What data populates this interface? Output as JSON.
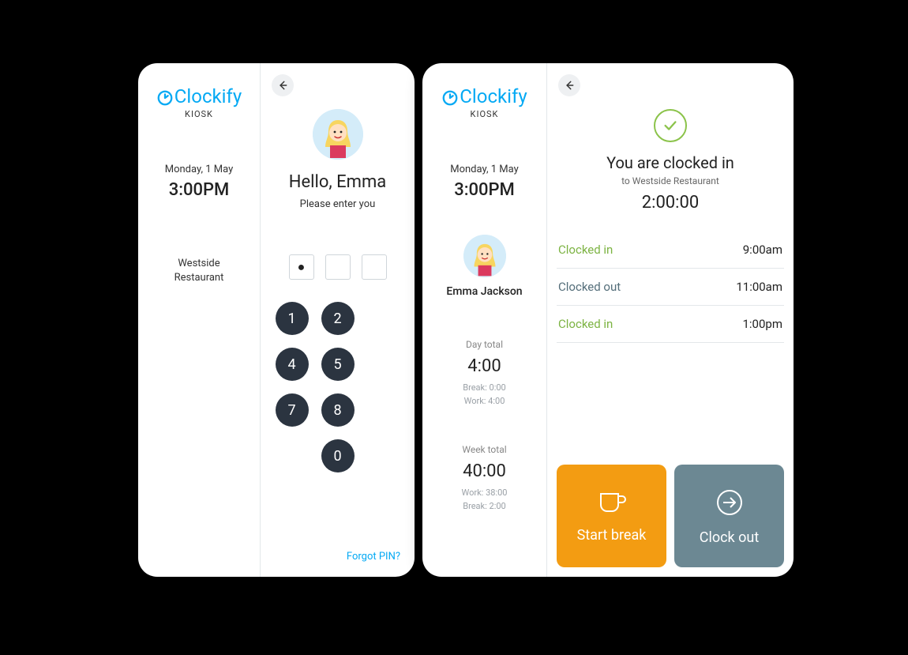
{
  "brand": {
    "name": "Clockify",
    "kiosk_label": "KIOSK"
  },
  "left": {
    "date": "Monday, 1 May",
    "time": "3:00PM",
    "location": "Westside Restaurant",
    "hello": "Hello, Emma",
    "instruction": "Please enter you",
    "pin_boxes": [
      "●",
      "",
      ""
    ],
    "keys": [
      "1",
      "2",
      "4",
      "5",
      "7",
      "8",
      "0"
    ],
    "forgot": "Forgot PIN?"
  },
  "right": {
    "date": "Monday, 1 May",
    "time": "3:00PM",
    "person": "Emma Jackson",
    "day_label": "Day total",
    "day_total": "4:00",
    "day_break": "Break: 0:00",
    "day_work": "Work: 4:00",
    "week_label": "Week total",
    "week_total": "40:00",
    "week_work": "Work: 38:00",
    "week_break": "Break: 2:00",
    "status_title": "You are clocked in",
    "status_sub": "to Westside Restaurant",
    "elapsed": "2:00:00",
    "log": [
      {
        "label": "Clocked in",
        "time": "9:00am",
        "kind": "in"
      },
      {
        "label": "Clocked out",
        "time": "11:00am",
        "kind": "out"
      },
      {
        "label": "Clocked in",
        "time": "1:00pm",
        "kind": "in"
      }
    ],
    "start_break": "Start break",
    "clock_out": "Clock out"
  }
}
